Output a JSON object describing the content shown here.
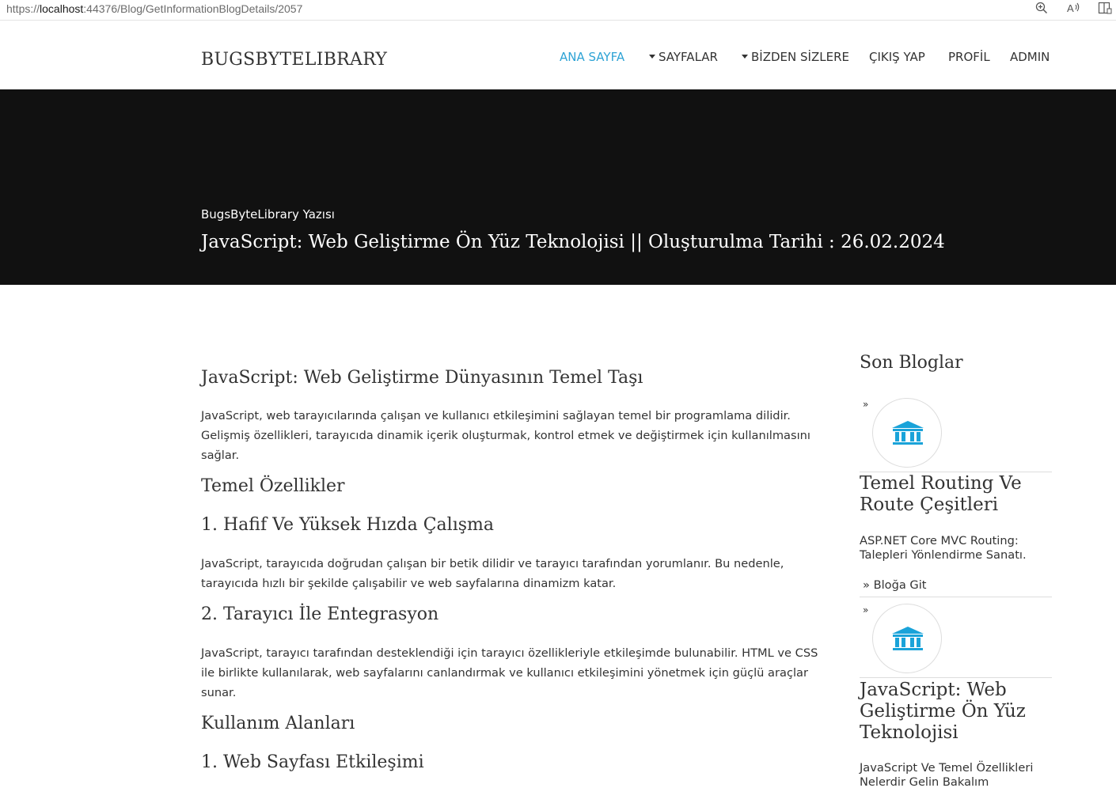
{
  "browser": {
    "url_prefix": "https://",
    "url_host": "localhost",
    "url_rest": ":44376/Blog/GetInformationBlogDetails/2057",
    "tools": [
      {
        "name": "zoom-icon",
        "glyph": "⊕"
      },
      {
        "name": "read-aloud-icon",
        "glyph": "A"
      },
      {
        "name": "reader-mode-icon",
        "glyph": "▯"
      }
    ]
  },
  "header": {
    "brand": "BUGSBYTELIBRARY",
    "nav": [
      {
        "label": "ANA SAYFA",
        "active": true,
        "dropdown": false
      },
      {
        "label": "SAYFALAR",
        "active": false,
        "dropdown": true
      },
      {
        "label": "BİZDEN SİZLERE",
        "active": false,
        "dropdown": true
      },
      {
        "label": "ÇIKIŞ YAP",
        "active": false,
        "dropdown": false
      },
      {
        "label": "PROFİL",
        "active": false,
        "dropdown": false
      },
      {
        "label": "ADMIN",
        "active": false,
        "dropdown": false
      }
    ]
  },
  "hero": {
    "subtitle": "BugsByteLibrary Yazısı",
    "title": "JavaScript: Web Geliştirme Ön Yüz Teknolojisi || Oluşturulma Tarihi : 26.02.2024"
  },
  "article": {
    "heading": "JavaScript: Web Geliştirme Dünyasının Temel Taşı",
    "intro": "JavaScript, web tarayıcılarında çalışan ve kullanıcı etkileşimini sağlayan temel bir programlama dilidir. Gelişmiş özellikleri, tarayıcıda dinamik içerik oluşturmak, kontrol etmek ve değiştirmek için kullanılmasını sağlar.",
    "section1": "Temel Özellikler",
    "sub1": "1. Hafif Ve Yüksek Hızda Çalışma",
    "sub1_text": "JavaScript, tarayıcıda doğrudan çalışan bir betik dilidir ve tarayıcı tarafından yorumlanır. Bu nedenle, tarayıcıda hızlı bir şekilde çalışabilir ve web sayfalarına dinamizm katar.",
    "sub2": "2. Tarayıcı İle Entegrasyon",
    "sub2_text": "JavaScript, tarayıcı tarafından desteklendiği için tarayıcı özellikleriyle etkileşimde bulunabilir. HTML ve CSS ile birlikte kullanılarak, web sayfalarını canlandırmak ve kullanıcı etkileşimini yönetmek için güçlü araçlar sunar.",
    "section2": "Kullanım Alanları",
    "sub3": "1. Web Sayfası Etkileşimi"
  },
  "sidebar": {
    "title": "Son Bloglar",
    "bullet": "»",
    "icon_color": "#1aa3d9",
    "posts": [
      {
        "title": "Temel Routing Ve Route Çeşitleri",
        "desc": "ASP.NET Core MVC Routing: Talepleri Yönlendirme Sanatı.",
        "link": "» Bloğa Git"
      },
      {
        "title": "JavaScript: Web Geliştirme Ön Yüz Teknolojisi",
        "desc": "JavaScript Ve Temel Özellikleri Nelerdir Gelin Bakalım"
      }
    ]
  }
}
